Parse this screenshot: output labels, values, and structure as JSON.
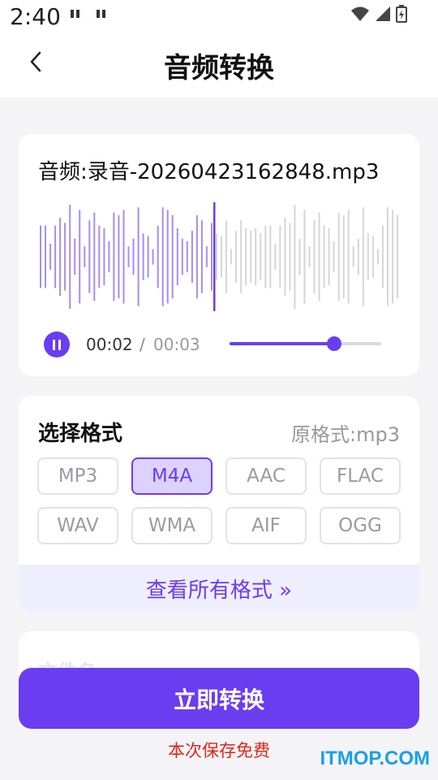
{
  "status_bar": {
    "time": "2:40",
    "notif_icons": [
      "notification-icon",
      "notification-icon"
    ],
    "icons": [
      "wifi-icon",
      "signal-icon",
      "battery-icon"
    ]
  },
  "nav": {
    "title": "音频转换",
    "back_icon": "chevron-left-icon"
  },
  "audio": {
    "file_name": "音频:录音-20260423162848.mp3",
    "current_time": "00:02",
    "separator": "/",
    "total_time": "00:03",
    "progress": 0.69,
    "play_state_icon": "pause-icon",
    "colors": {
      "accent": "#6a3df0",
      "played": "#a58df2",
      "unplayed": "#d6d6d6"
    }
  },
  "format_section": {
    "title": "选择格式",
    "original_format": "原格式:mp3",
    "formats": [
      "MP3",
      "M4A",
      "AAC",
      "FLAC",
      "WAV",
      "WMA",
      "AIF",
      "OGG"
    ],
    "selected": "M4A",
    "view_all": "查看所有格式 »"
  },
  "next_section": {
    "label": "文件名"
  },
  "convert_button": "立即转换",
  "free_note": "本次保存免费",
  "watermark": "ITMOP.COM"
}
